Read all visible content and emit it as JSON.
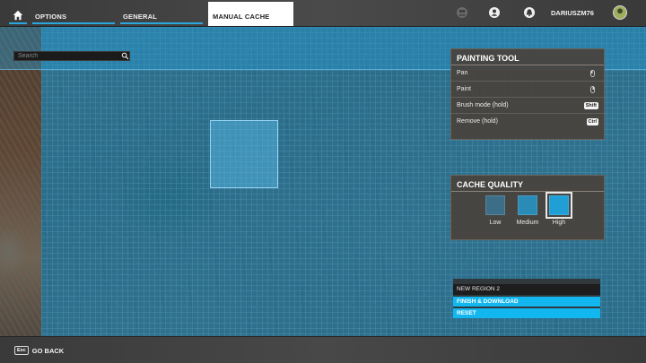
{
  "nav": {
    "tabs": [
      {
        "label": "OPTIONS"
      },
      {
        "label": "GENERAL"
      },
      {
        "label": "MANUAL CACHE"
      }
    ],
    "username": "DARIUSZM76"
  },
  "search": {
    "placeholder": "Search"
  },
  "painting_tool": {
    "title": "PAINTING TOOL",
    "rows": [
      {
        "label": "Pan",
        "input": "mouse-left"
      },
      {
        "label": "Paint",
        "input": "mouse-right"
      },
      {
        "label": "Brush mode (hold)",
        "key": "Shift"
      },
      {
        "label": "Remove (hold)",
        "key": "Ctrl"
      }
    ]
  },
  "cache_quality": {
    "title": "CACHE QUALITY",
    "options": [
      {
        "label": "Low",
        "color": "#3c6f87"
      },
      {
        "label": "Medium",
        "color": "#2a8bb7"
      },
      {
        "label": "High",
        "color": "#1f9fd6",
        "selected": true
      }
    ]
  },
  "region": {
    "name": "NEW REGION 2",
    "finish_label": "FINISH & DOWNLOAD",
    "reset_label": "RESET"
  },
  "footer": {
    "key": "Esc",
    "back_label": "GO BACK"
  },
  "colors": {
    "accent": "#29a8e0",
    "button": "#13b7ef",
    "overlay": "#1880b2"
  }
}
